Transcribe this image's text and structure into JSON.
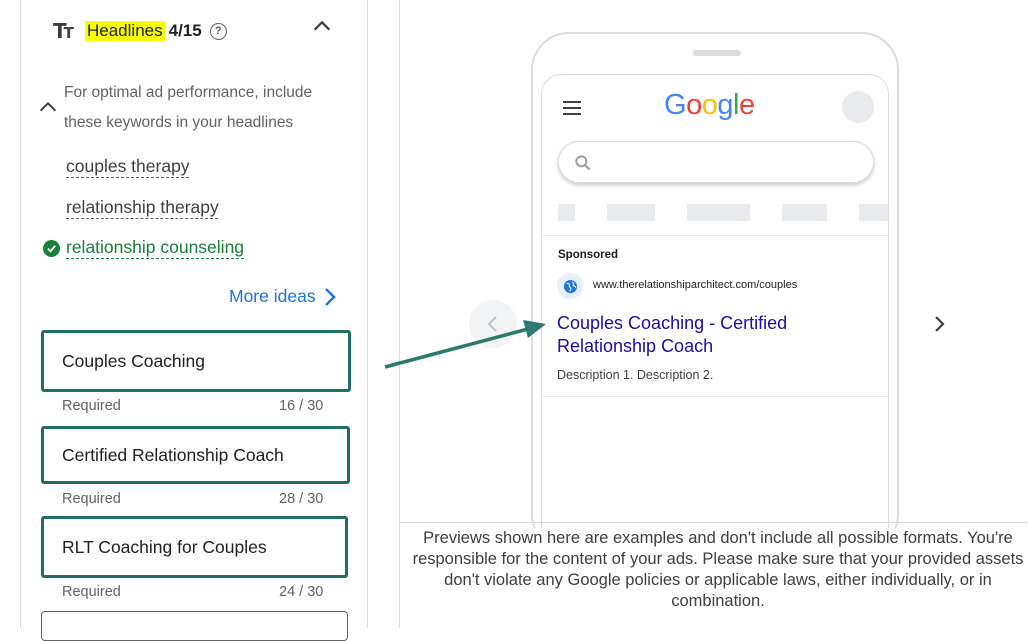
{
  "headlines_section": {
    "title": "Headlines",
    "count": "4/15",
    "keyword_hint": "For optimal ad performance, include these keywords in your headlines",
    "keywords": [
      {
        "text": "couples therapy",
        "included": false
      },
      {
        "text": "relationship therapy",
        "included": false
      },
      {
        "text": "relationship counseling",
        "included": true
      }
    ],
    "more_ideas_label": "More ideas",
    "fields": [
      {
        "value": "Couples Coaching",
        "required_label": "Required",
        "char_count": "16 / 30"
      },
      {
        "value": "Certified Relationship Coach",
        "required_label": "Required",
        "char_count": "28 / 30"
      },
      {
        "value": "RLT Coaching for Couples",
        "required_label": "Required",
        "char_count": "24 / 30"
      }
    ]
  },
  "preview": {
    "logo_letters": [
      {
        "char": "G",
        "color": "#4285F4"
      },
      {
        "char": "o",
        "color": "#EA4335"
      },
      {
        "char": "o",
        "color": "#FBBC05"
      },
      {
        "char": "g",
        "color": "#4285F4"
      },
      {
        "char": "l",
        "color": "#34A853"
      },
      {
        "char": "e",
        "color": "#EA4335"
      }
    ],
    "ad": {
      "sponsored_label": "Sponsored",
      "url": "www.therelationshiparchitect.com/couples",
      "title": "Couples Coaching - Certified Relationship Coach",
      "description": "Description 1. Description 2."
    },
    "disclaimer": "Previews shown here are examples and don't include all possible formats. You're responsible for the content of your ads. Please make sure that your provided assets don't violate any Google policies or applicable laws, either individually, or in combination."
  },
  "colors": {
    "highlight": "#f6ff00",
    "field_border": "#1e6e66",
    "link_blue": "#1a73e8",
    "ad_title_blue": "#1a0dab",
    "check_green": "#188038",
    "annotation_arrow": "#2a7a71"
  },
  "icons": {
    "text_format": "text-format-icon",
    "help": "help-circle-icon",
    "collapse": "chevron-up-icon",
    "check": "check-circle-icon",
    "more": "chevron-right-icon",
    "menu": "hamburger-menu-icon",
    "search": "search-icon",
    "globe": "globe-icon",
    "prev": "chevron-left-icon",
    "next": "chevron-right-icon"
  }
}
